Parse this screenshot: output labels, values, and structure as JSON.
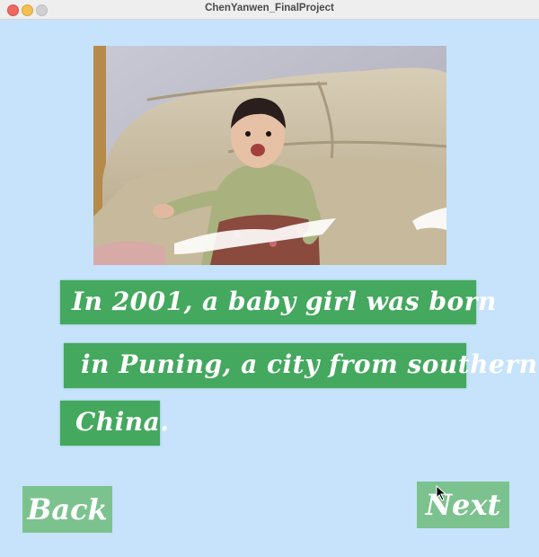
{
  "window": {
    "title": "ChenYanwen_FinalProject"
  },
  "story": {
    "lines": [
      "In 2001, a baby girl was born",
      "in Puning, a city from southern",
      "China."
    ]
  },
  "nav": {
    "back_label": "Back",
    "next_label": "Next"
  },
  "colors": {
    "background": "#c6e3fb",
    "text_brush": "#44a85f",
    "button_brush": "#7cc28e",
    "text": "#ffffff"
  }
}
